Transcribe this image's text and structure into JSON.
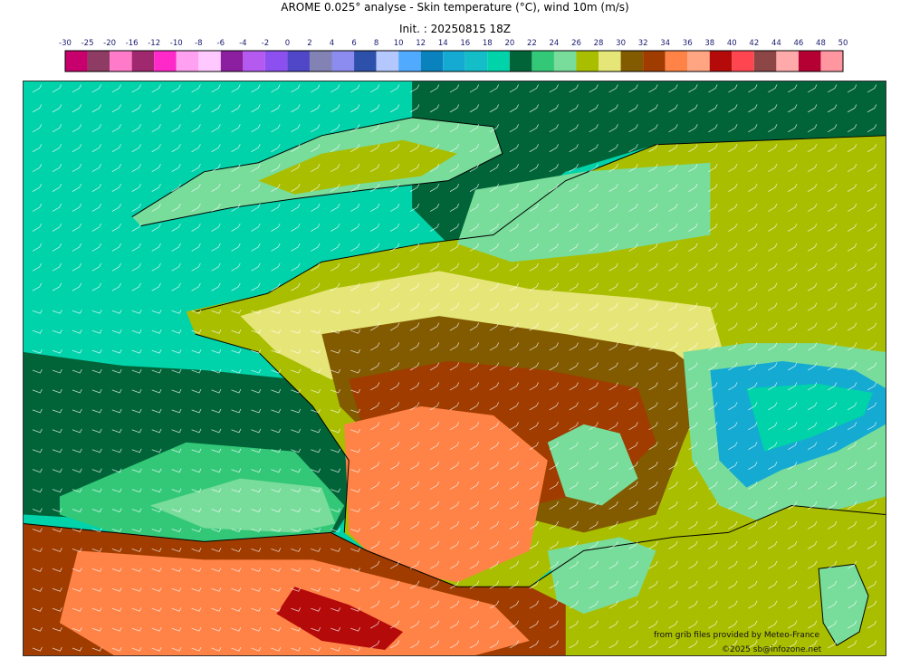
{
  "title_line1": "AROME 0.025° analyse - Skin temperature (°C), wind 10m (m/s)",
  "title_line2": "Init. : 20250815 18Z",
  "colorbar": {
    "ticks": [
      "-30",
      "-25",
      "-20",
      "-16",
      "-12",
      "-10",
      "-8",
      "-6",
      "-4",
      "-2",
      "0",
      "2",
      "4",
      "6",
      "8",
      "10",
      "12",
      "14",
      "16",
      "18",
      "20",
      "22",
      "24",
      "26",
      "28",
      "30",
      "32",
      "34",
      "36",
      "38",
      "40",
      "42",
      "44",
      "46",
      "48",
      "50"
    ],
    "colors": [
      "#c8006e",
      "#8e3c64",
      "#ff7ac8",
      "#a0286e",
      "#ff28c8",
      "#ffa0f0",
      "#ffc8ff",
      "#8c1ea0",
      "#b45af0",
      "#8c50f0",
      "#5046c8",
      "#8282b4",
      "#8c8cf0",
      "#2d50aa",
      "#b4c8ff",
      "#50aaff",
      "#0a82be",
      "#14aad2",
      "#14bec8",
      "#00d2aa",
      "#006438",
      "#32c878",
      "#78dc9b",
      "#aabe00",
      "#e6e678",
      "#825a00",
      "#a03c00",
      "#ff8246",
      "#ffa582",
      "#b40a0a",
      "#ff4650",
      "#8c4646",
      "#ffaaaa",
      "#b40032",
      "#ff96a0"
    ]
  },
  "map_layers": {
    "sea_atlantic": "#00d2aa",
    "sea_deep": "#006438",
    "sea_med": "#aabe00",
    "land_south": "#ff8246",
    "land_brown": "#825a00",
    "land_rust": "#a03c00",
    "land_yellow": "#e6e678",
    "land_olive": "#aabe00",
    "land_green": "#78dc9b",
    "alps_blue": "#14aad2",
    "hot_red": "#b40a0a"
  },
  "credit_line1": "from grib files provided by Meteo-France",
  "credit_line2": "©2025 sb@infozone.net"
}
